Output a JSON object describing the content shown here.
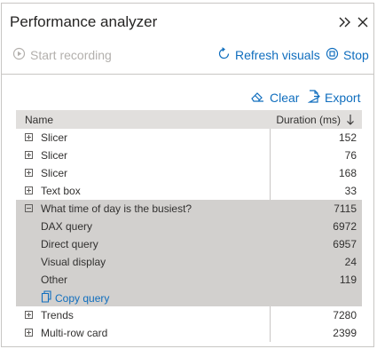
{
  "title": "Performance analyzer",
  "header_icons": {
    "collapse": "double-chevron-right-icon",
    "close": "close-icon"
  },
  "toolbar": {
    "start_recording": "Start recording",
    "refresh_visuals": "Refresh visuals",
    "stop": "Stop"
  },
  "actions": {
    "clear": "Clear",
    "export": "Export"
  },
  "table": {
    "col_name": "Name",
    "col_duration": "Duration (ms)",
    "rows": [
      {
        "label": "Slicer",
        "value": "152"
      },
      {
        "label": "Slicer",
        "value": "76"
      },
      {
        "label": "Slicer",
        "value": "168"
      },
      {
        "label": "Text box",
        "value": "33"
      },
      {
        "label": "What time of day is the busiest?",
        "value": "7115"
      },
      {
        "label": "DAX query",
        "value": "6972"
      },
      {
        "label": "Direct query",
        "value": "6957"
      },
      {
        "label": "Visual display",
        "value": "24"
      },
      {
        "label": "Other",
        "value": "119"
      },
      {
        "label": "Copy query",
        "value": ""
      },
      {
        "label": "Trends",
        "value": "7280"
      },
      {
        "label": "Multi-row card",
        "value": "2399"
      }
    ]
  },
  "colors": {
    "accent": "#106ebe",
    "selected_row": "#d2d0ce",
    "header_bg": "#e1dfdd"
  }
}
